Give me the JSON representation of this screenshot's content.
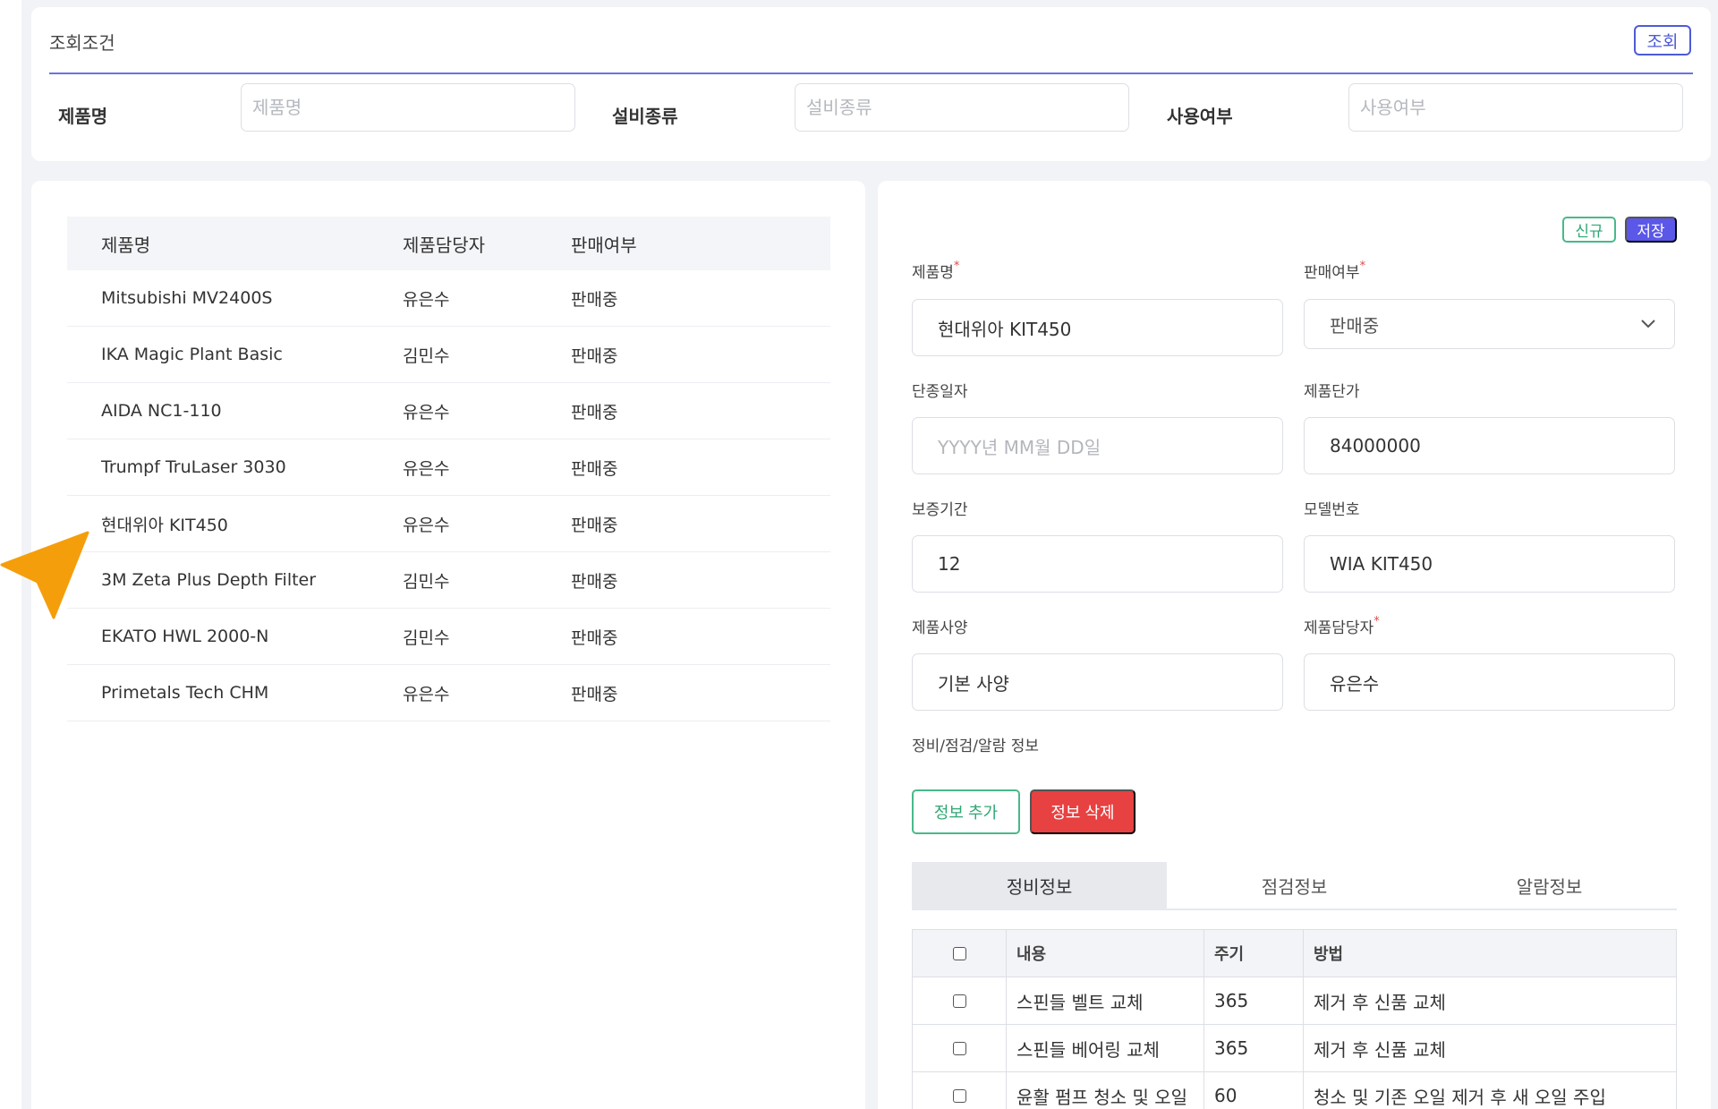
{
  "search": {
    "title": "조회조건",
    "search_button": "조회",
    "fields": [
      {
        "label": "제품명",
        "placeholder": "제품명"
      },
      {
        "label": "설비종류",
        "placeholder": "설비종류"
      },
      {
        "label": "사용여부",
        "placeholder": "사용여부"
      }
    ]
  },
  "list": {
    "headers": [
      "제품명",
      "제품담당자",
      "판매여부"
    ],
    "rows": [
      {
        "name": "Mitsubishi MV2400S",
        "manager": "유은수",
        "status": "판매중"
      },
      {
        "name": "IKA Magic Plant Basic",
        "manager": "김민수",
        "status": "판매중"
      },
      {
        "name": "AIDA NC1-110",
        "manager": "유은수",
        "status": "판매중"
      },
      {
        "name": "Trumpf TruLaser 3030",
        "manager": "유은수",
        "status": "판매중"
      },
      {
        "name": "현대위아 KIT450",
        "manager": "유은수",
        "status": "판매중"
      },
      {
        "name": "3M Zeta Plus Depth Filter",
        "manager": "김민수",
        "status": "판매중"
      },
      {
        "name": "EKATO HWL 2000-N",
        "manager": "김민수",
        "status": "판매중"
      },
      {
        "name": "Primetals Tech CHM",
        "manager": "유은수",
        "status": "판매중"
      }
    ]
  },
  "detail": {
    "new_button": "신규",
    "save_button": "저장",
    "required_mark": "*",
    "product_name": {
      "label": "제품명",
      "value": "현대위아 KIT450"
    },
    "sale_status": {
      "label": "판매여부",
      "value": "판매중"
    },
    "discontinued_date": {
      "label": "단종일자",
      "placeholder": "YYYY년 MM월 DD일"
    },
    "unit_price": {
      "label": "제품단가",
      "value": "84000000"
    },
    "warranty": {
      "label": "보증기간",
      "value": "12"
    },
    "model_no": {
      "label": "모델번호",
      "value": "WIA KIT450"
    },
    "spec": {
      "label": "제품사양",
      "value": "기본 사양"
    },
    "manager": {
      "label": "제품담당자",
      "value": "유은수"
    },
    "section_title": "정비/점검/알람 정보",
    "add_button": "정보 추가",
    "delete_button": "정보 삭제",
    "tabs": [
      "정비정보",
      "점검정보",
      "알람정보"
    ],
    "table": {
      "headers": [
        "내용",
        "주기",
        "방법"
      ],
      "rows": [
        {
          "content": "스핀들 벨트 교체",
          "cycle": "365",
          "method": "제거 후 신품 교체"
        },
        {
          "content": "스핀들 베어링 교체",
          "cycle": "365",
          "method": "제거 후 신품 교체"
        },
        {
          "content": "윤활 펌프 청소 및 오일",
          "cycle": "60",
          "method": "청소 및 기존 오일 제거 후 새 오일 주입"
        }
      ]
    }
  },
  "colors": {
    "accent": "#5b57e8",
    "green": "#2fa774",
    "red": "#e84141",
    "cursor": "#f59e0b"
  }
}
